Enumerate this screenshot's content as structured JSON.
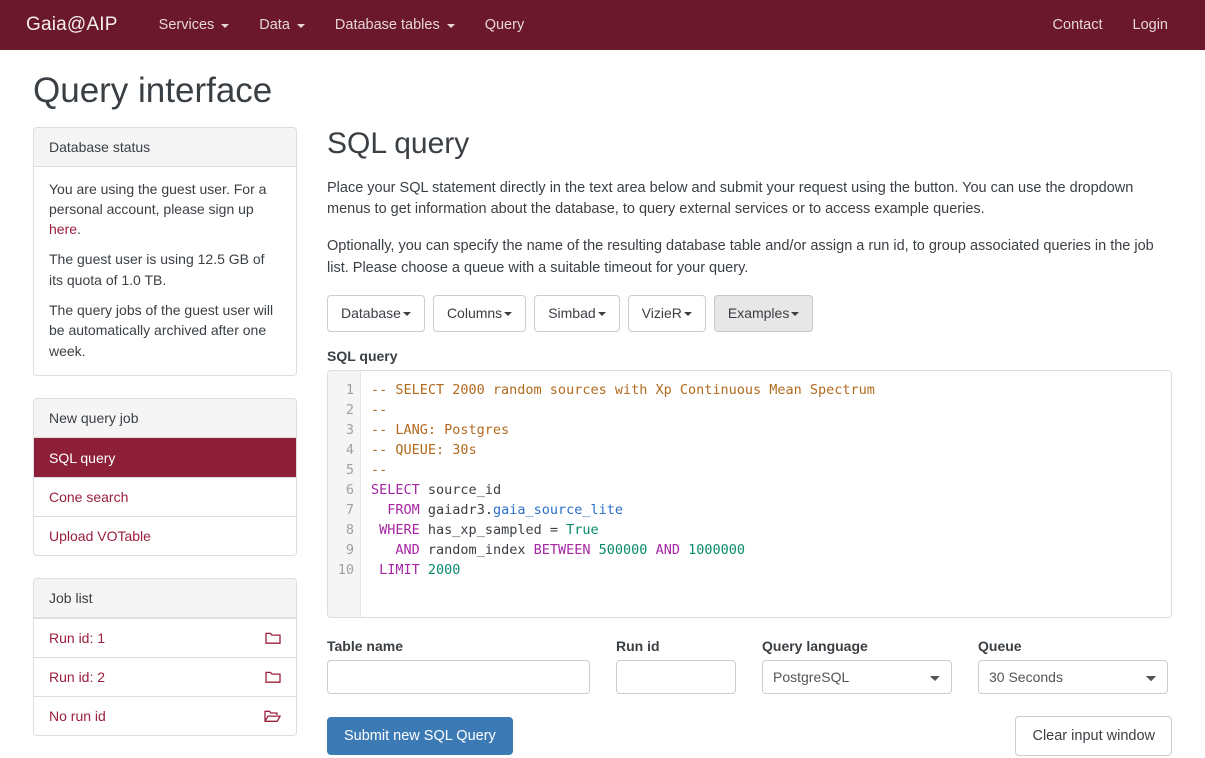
{
  "navbar": {
    "brand": "Gaia@AIP",
    "items": [
      {
        "label": "Services",
        "caret": true
      },
      {
        "label": "Data",
        "caret": true
      },
      {
        "label": "Database tables",
        "caret": true
      },
      {
        "label": "Query",
        "caret": false
      }
    ],
    "right_items": [
      {
        "label": "Contact"
      },
      {
        "label": "Login"
      }
    ],
    "background_color": "#6b172c"
  },
  "page": {
    "title": "Query interface"
  },
  "sidebar": {
    "status_panel": {
      "heading": "Database status",
      "paragraph_1_before_link": "You are using the guest user. For a personal account, please sign up ",
      "paragraph_1_link": "here",
      "paragraph_1_after_link": ".",
      "paragraph_2": "The guest user is using 12.5 GB of its quota of 1.0 TB.",
      "paragraph_3": "The query jobs of the guest user will be automatically archived after one week."
    },
    "new_query_panel": {
      "heading": "New query job",
      "items": [
        {
          "label": "SQL query",
          "active": true,
          "icon": ""
        },
        {
          "label": "Cone search",
          "active": false,
          "icon": ""
        },
        {
          "label": "Upload VOTable",
          "active": false,
          "icon": ""
        }
      ]
    },
    "job_list_panel": {
      "heading": "Job list",
      "items": [
        {
          "label": "Run id: 1",
          "icon": "folder-closed-icon"
        },
        {
          "label": "Run id: 2",
          "icon": "folder-closed-icon"
        },
        {
          "label": "No run id",
          "icon": "folder-open-icon"
        }
      ]
    }
  },
  "main": {
    "title": "SQL query",
    "paragraph_1": "Place your SQL statement directly in the text area below and submit your request using the button. You can use the dropdown menus to get information about the database, to query external services or to access example queries.",
    "paragraph_2": "Optionally, you can specify the name of the resulting database table and/or assign a run id, to group associated queries in the job list. Please choose a queue with a suitable timeout for your query.",
    "toolbar": {
      "database_label": "Database",
      "columns_label": "Columns",
      "simbad_label": "Simbad",
      "vizier_label": "VizieR",
      "examples_label": "Examples"
    },
    "editor": {
      "label": "SQL query",
      "line_numbers": [
        "1",
        "2",
        "3",
        "4",
        "5",
        "6",
        "7",
        "8",
        "9",
        "10"
      ],
      "lines": [
        "-- SELECT 2000 random sources with Xp Continuous Mean Spectrum",
        "--",
        "-- LANG: Postgres",
        "-- QUEUE: 30s",
        "--",
        "SELECT source_id",
        "  FROM gaiadr3.gaia_source_lite",
        " WHERE has_xp_sampled = True",
        "   AND random_index BETWEEN 500000 AND 1000000",
        " LIMIT 2000"
      ]
    },
    "form": {
      "table_name_label": "Table name",
      "table_name_value": "",
      "table_name_placeholder": "",
      "run_id_label": "Run id",
      "run_id_value": "",
      "run_id_placeholder": "",
      "query_language_label": "Query language",
      "query_language_value": "PostgreSQL",
      "queue_label": "Queue",
      "queue_value": "30 Seconds"
    },
    "actions": {
      "submit_label": "Submit new SQL Query",
      "clear_label": "Clear input window",
      "submit_color": "#3b7ab5"
    }
  }
}
